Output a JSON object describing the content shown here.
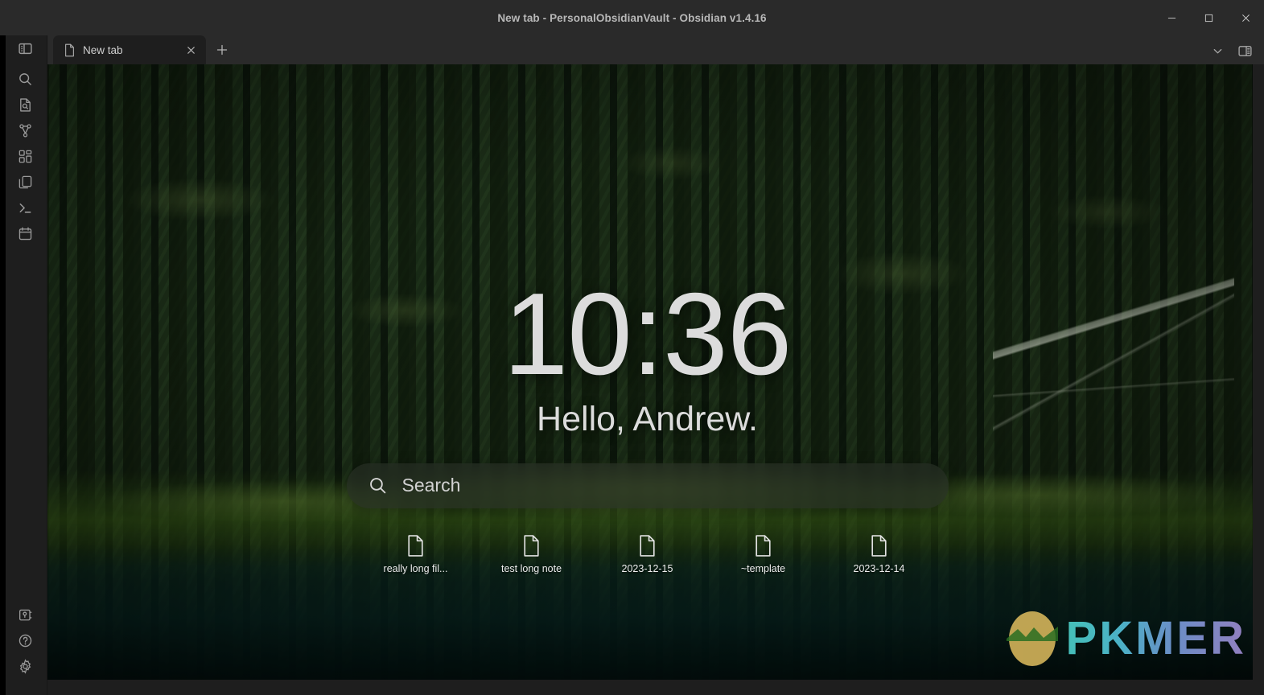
{
  "window": {
    "title": "New tab - PersonalObsidianVault - Obsidian v1.4.16",
    "minimize_label": "–",
    "maximize_label": "□",
    "close_label": "✕"
  },
  "ribbon": {
    "logo": "obsidian-logo-icon",
    "top_items": [
      {
        "name": "toggle-left-sidebar-icon",
        "label": "Toggle left sidebar"
      }
    ],
    "items": [
      {
        "name": "search-icon",
        "label": "Search"
      },
      {
        "name": "file-search-icon",
        "label": "Search in file"
      },
      {
        "name": "graph-view-icon",
        "label": "Open graph view"
      },
      {
        "name": "canvas-icon",
        "label": "Create new canvas"
      },
      {
        "name": "copy-files-icon",
        "label": "Open another vault"
      },
      {
        "name": "terminal-icon",
        "label": "Open terminal"
      },
      {
        "name": "calendar-icon",
        "label": "Open calendar"
      }
    ],
    "bottom_items": [
      {
        "name": "vault-switcher-icon",
        "label": "Open another vault"
      },
      {
        "name": "help-icon",
        "label": "Help"
      },
      {
        "name": "settings-gear-icon",
        "label": "Settings"
      }
    ]
  },
  "tabbar": {
    "tabs": [
      {
        "label": "New tab",
        "icon": "file-icon",
        "close_label": "✕",
        "active": true
      }
    ],
    "add_tab_label": "+",
    "right_controls": [
      {
        "name": "chevron-down-icon",
        "label": "Tab list"
      },
      {
        "name": "toggle-right-sidebar-icon",
        "label": "Toggle right sidebar"
      }
    ]
  },
  "home": {
    "clock": "10:36",
    "greeting": "Hello, Andrew.",
    "search": {
      "value": "",
      "placeholder": "Search",
      "icon": "search-icon"
    },
    "shortcuts": [
      {
        "label": "really long fil...",
        "icon": "file-icon"
      },
      {
        "label": "test long note",
        "icon": "file-icon"
      },
      {
        "label": "2023-12-15",
        "icon": "file-icon"
      },
      {
        "label": "~template",
        "icon": "file-icon"
      },
      {
        "label": "2023-12-14",
        "icon": "file-icon"
      }
    ]
  },
  "watermark": {
    "text": "PKMER",
    "logo": "pkmer-egg-logo-icon"
  },
  "colors": {
    "titlebar_bg": "#2a2a2a",
    "ribbon_bg": "#1e1e1e",
    "tab_active_bg": "#1e1e1e",
    "text_primary": "#dcdcdc",
    "text_muted": "#9a9a9a",
    "watermark_gradient_start": "#4fd8d0",
    "watermark_gradient_end": "#a78fd8",
    "watermark_logo": "#d9b85c"
  }
}
